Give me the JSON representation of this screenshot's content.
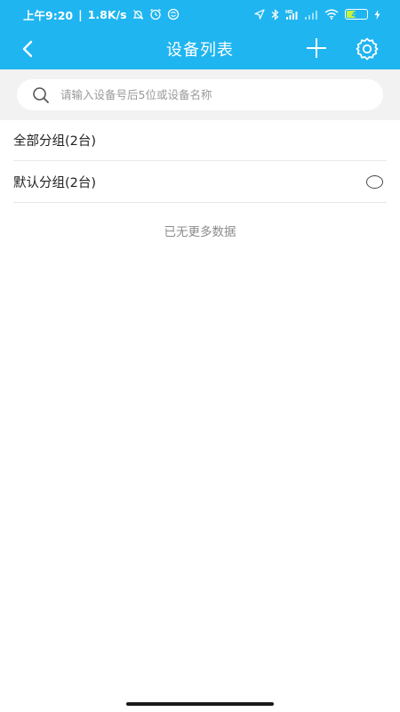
{
  "status_bar": {
    "time": "上午9:20",
    "speed": "1.8K/s",
    "separator": "|",
    "battery": "48",
    "battery_level": 0.48,
    "icons": [
      "mute-bell-icon",
      "alarm-icon",
      "sync-icon",
      "location-icon",
      "bluetooth-icon",
      "hd-signal-icon",
      "cellular-signal-icon",
      "wifi-icon",
      "battery-icon",
      "charging-icon"
    ]
  },
  "header": {
    "title": "设备列表",
    "background": "#1fb5f0",
    "icons": [
      "back-arrow-icon",
      "plus-icon",
      "gear-icon"
    ]
  },
  "search": {
    "placeholder": "请输入设备号后5位或设备名称",
    "value": "",
    "icon": "search-icon"
  },
  "groups": [
    {
      "label": "全部分组(2台)",
      "has_radio": false
    },
    {
      "label": "默认分组(2台)",
      "has_radio": true,
      "selected": false
    }
  ],
  "footer_text": "已无更多数据"
}
